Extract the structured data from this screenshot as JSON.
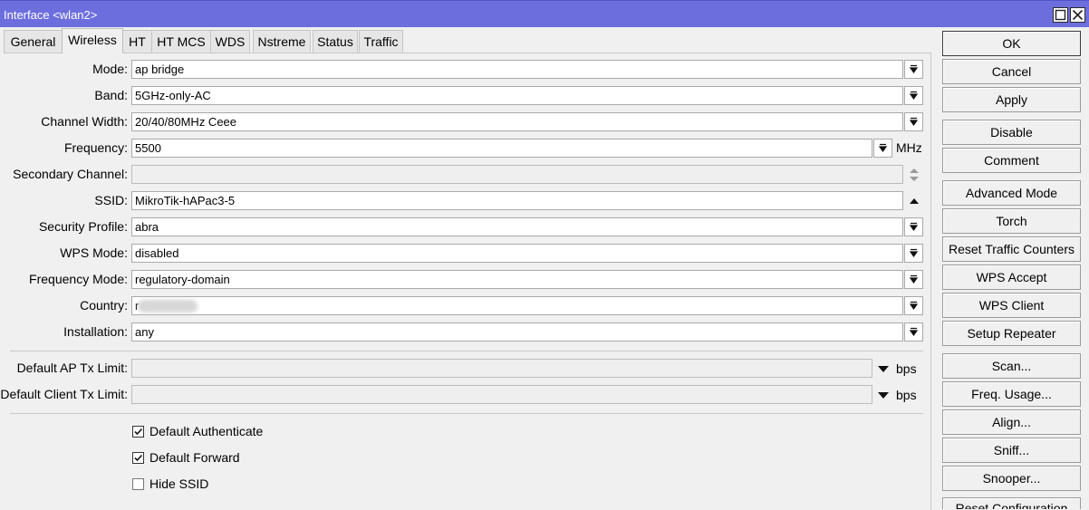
{
  "window": {
    "title": "Interface <wlan2>"
  },
  "tabs": [
    "General",
    "Wireless",
    "HT",
    "HT MCS",
    "WDS",
    "Nstreme",
    "Status",
    "Traffic"
  ],
  "active_tab": "Wireless",
  "fields": {
    "mode": {
      "label": "Mode:",
      "value": "ap bridge"
    },
    "band": {
      "label": "Band:",
      "value": "5GHz-only-AC"
    },
    "channel_width": {
      "label": "Channel Width:",
      "value": "20/40/80MHz Ceee"
    },
    "frequency": {
      "label": "Frequency:",
      "value": "5500",
      "unit": "MHz"
    },
    "secondary_channel": {
      "label": "Secondary Channel:",
      "value": ""
    },
    "ssid": {
      "label": "SSID:",
      "value": "MikroTik-hAPac3-5"
    },
    "security_profile": {
      "label": "Security Profile:",
      "value": "abra"
    },
    "wps_mode": {
      "label": "WPS Mode:",
      "value": "disabled"
    },
    "frequency_mode": {
      "label": "Frequency Mode:",
      "value": "regulatory-domain"
    },
    "country": {
      "label": "Country:",
      "value": "r"
    },
    "installation": {
      "label": "Installation:",
      "value": "any"
    },
    "default_ap_tx_limit": {
      "label": "Default AP Tx Limit:",
      "value": "",
      "unit": "bps"
    },
    "default_client_tx_limit": {
      "label": "Default Client Tx Limit:",
      "value": "",
      "unit": "bps"
    }
  },
  "checkboxes": {
    "default_authenticate": {
      "label": "Default Authenticate",
      "checked": true
    },
    "default_forward": {
      "label": "Default Forward",
      "checked": true
    },
    "hide_ssid": {
      "label": "Hide SSID",
      "checked": false
    }
  },
  "buttons": {
    "ok": "OK",
    "cancel": "Cancel",
    "apply": "Apply",
    "disable": "Disable",
    "comment": "Comment",
    "advanced_mode": "Advanced Mode",
    "torch": "Torch",
    "reset_traffic_counters": "Reset Traffic Counters",
    "wps_accept": "WPS Accept",
    "wps_client": "WPS Client",
    "setup_repeater": "Setup Repeater",
    "scan": "Scan...",
    "freq_usage": "Freq. Usage...",
    "align": "Align...",
    "sniff": "Sniff...",
    "snooper": "Snooper...",
    "reset_configuration": "Reset Configuration"
  },
  "icons": {
    "dropdown": "dropdown-arrow-icon",
    "updown": "up-down-arrow-icon",
    "up": "up-arrow-icon",
    "down": "down-arrow-icon",
    "maximize": "maximize-icon",
    "close": "close-icon"
  },
  "colors": {
    "titlebar": "#6d6ede",
    "background": "#f0f0f0"
  }
}
